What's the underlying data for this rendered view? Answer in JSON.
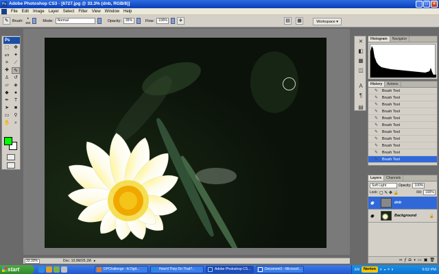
{
  "window": {
    "title": "Adobe Photoshop CS3 - [6727.jpg @ 33.3% (dnb, RGB/8)]"
  },
  "menu": [
    "File",
    "Edit",
    "Image",
    "Layer",
    "Select",
    "Filter",
    "View",
    "Window",
    "Help"
  ],
  "options": {
    "brush_label": "Brush:",
    "brush_size": "150",
    "mode_label": "Mode:",
    "mode_value": "Normal",
    "opacity_label": "Opacity:",
    "opacity_value": "35%",
    "flow_label": "Flow:",
    "flow_value": "100%",
    "workspace_label": "Workspace ▾"
  },
  "toolbox": {
    "logo": "Ps"
  },
  "status": {
    "zoom": "33.33%",
    "doc": "Doc: 10.0M/25.1M"
  },
  "histogram_panel": {
    "tabs": [
      "Histogram",
      "Navigator"
    ]
  },
  "history_panel": {
    "tabs": [
      "History",
      "Actions"
    ],
    "items": [
      "Brush Tool",
      "Brush Tool",
      "Brush Tool",
      "Brush Tool",
      "Brush Tool",
      "Brush Tool",
      "Brush Tool",
      "Brush Tool",
      "Brush Tool",
      "Brush Tool",
      "Brush Tool"
    ]
  },
  "layers_panel": {
    "tabs": [
      "Layers",
      "Channels"
    ],
    "blend_mode": "Soft Light",
    "opacity_label": "Opacity:",
    "opacity_value": "100%",
    "lock_label": "Lock:",
    "fill_label": "Fill:",
    "fill_value": "100%",
    "layers": [
      {
        "name": "dnb",
        "selected": true
      },
      {
        "name": "Background",
        "selected": false
      }
    ]
  },
  "taskbar": {
    "start_label": "start",
    "tasks": [
      {
        "label": "DPChallenge - A Digit...",
        "color": "#e07a2a"
      },
      {
        "label": "How'd They Do That?...",
        "color": "#2a8ae0"
      },
      {
        "label": "Adobe Photoshop CS...",
        "color": "#1a4fa8"
      },
      {
        "label": "Document1 - Microsof...",
        "color": "#2a5cd8"
      }
    ],
    "tray": {
      "norton": "Norton",
      "lang": "EN",
      "clock": "6:52 PM"
    }
  },
  "colors": {
    "foreground": "#00ff00",
    "background": "#ffffff",
    "selection": "#3168d8"
  }
}
